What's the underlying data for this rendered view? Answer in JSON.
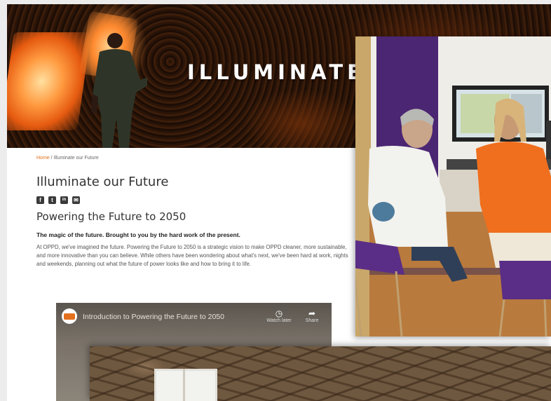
{
  "hero": {
    "title": "ILLUMINATE"
  },
  "breadcrumb": {
    "home": "Home",
    "separator": "/",
    "current": "Illuminate our Future"
  },
  "page": {
    "title": "Illuminate our Future",
    "subtitle": "Powering the Future to 2050",
    "lede": "The magic of the future. Brought to you by the hard work of the present.",
    "body": "At OPPD, we've imagined the future. Powering the Future to 2050 is a strategic vision to make OPPD cleaner, more sustainable, and more innovative than you can believe. While others have been wondering about what's next, we've been hard at work, nights and weekends, planning out what the future of power looks like and how to bring it to life."
  },
  "social": {
    "icons": [
      "facebook-icon",
      "twitter-icon",
      "linkedin-icon",
      "email-icon"
    ],
    "glyphs": [
      "f",
      "t",
      "in",
      "✉"
    ]
  },
  "video": {
    "title": "Introduction to Powering the Future to 2050",
    "watch_later": "Watch later",
    "share": "Share"
  },
  "colors": {
    "accent": "#e3701c",
    "hero_bg": "#1f0f06",
    "purple": "#4b2673"
  }
}
